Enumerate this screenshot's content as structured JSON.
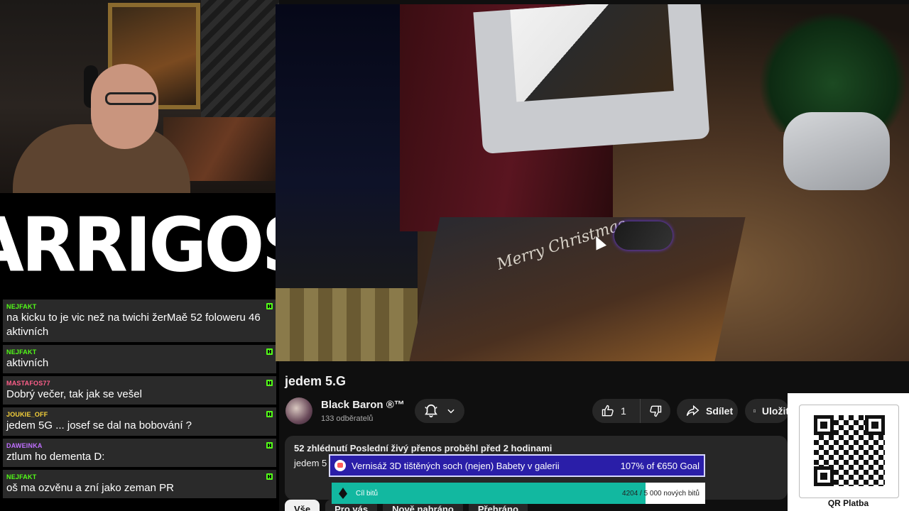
{
  "overlay": {
    "logo": "ARRIGOS",
    "chat": [
      {
        "user": "NEJFAKT",
        "color": "#53fc18",
        "text": "na kicku to je vic než na twichi žerMaě 52 foloweru 46 aktivních"
      },
      {
        "user": "NEJFAKT",
        "color": "#53fc18",
        "text": "aktivních"
      },
      {
        "user": "MASTAFOS77",
        "color": "#ff5f8a",
        "text": "Dobrý večer, tak jak se vešel"
      },
      {
        "user": "JOUKIE_OFF",
        "color": "#f7d23a",
        "text": "jedem 5G ... josef se dal na bobování ?"
      },
      {
        "user": "DAWEINKA",
        "color": "#c070ff",
        "text": "ztlum ho dementa D:"
      },
      {
        "user": "NEJFAKT",
        "color": "#53fc18",
        "text": "oš ma ozvěnu a zní jako zeman PR"
      }
    ],
    "goal": {
      "text": "Vernisáž 3D tištěných soch (nejen) Babety v galerii",
      "progress": "107% of €650 Goal"
    },
    "bits": {
      "label": "Cíl bitů",
      "count": "4204 / 5 000 nových bitů",
      "fraction": 0.84
    },
    "qr": {
      "label": "QR Platba"
    }
  },
  "video": {
    "mat_text": "Merry Christmas",
    "title": "jedem 5.G",
    "channel": "Black Baron ®™",
    "subscribers": "133 odběratelů",
    "likes": "1",
    "share_label": "Sdílet",
    "save_label": "Uložit",
    "description": {
      "meta": "52 zhlédnutí  Poslední živý přenos proběhl před 2 hodinami",
      "body": "jedem 5"
    },
    "chips": [
      "Vše",
      "Pro vás",
      "Nově nahráno",
      "Přehráno"
    ]
  },
  "colors": {
    "accent_goal": "#2a1ea8",
    "bits_fill": "#12b8a0",
    "kick_green": "#53fc18"
  }
}
